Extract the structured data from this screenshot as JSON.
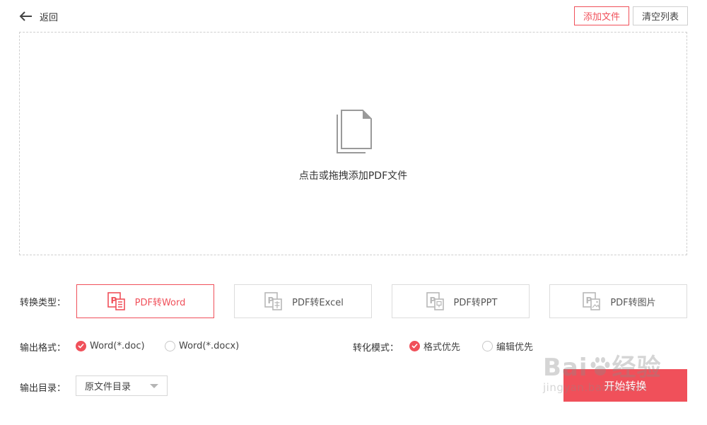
{
  "header": {
    "back_label": "返回",
    "add_file_label": "添加文件",
    "clear_list_label": "清空列表"
  },
  "dropzone": {
    "hint": "点击或拖拽添加PDF文件",
    "icon": "documents-icon"
  },
  "convert_type": {
    "label": "转换类型：",
    "selected": "PDF转Word",
    "options": [
      {
        "label": "PDF转Word",
        "icon": "pdf-word-icon"
      },
      {
        "label": "PDF转Excel",
        "icon": "pdf-excel-icon"
      },
      {
        "label": "PDF转PPT",
        "icon": "pdf-ppt-icon"
      },
      {
        "label": "PDF转图片",
        "icon": "pdf-image-icon"
      }
    ]
  },
  "output_format": {
    "label": "输出格式：",
    "selected": "Word(*.doc)",
    "options": [
      "Word(*.doc)",
      "Word(*.docx)"
    ]
  },
  "convert_mode": {
    "label": "转化模式：",
    "selected": "格式优先",
    "options": [
      "格式优先",
      "编辑优先"
    ]
  },
  "output_dir": {
    "label": "输出目录：",
    "value": "原文件目录"
  },
  "start_button": {
    "label": "开始转换"
  },
  "watermark": {
    "brand": "Bai",
    "brand_cn": "经验",
    "url": "jingyan.baidu.com"
  },
  "colors": {
    "accent": "#f0505a",
    "border": "#dcdcdc"
  }
}
